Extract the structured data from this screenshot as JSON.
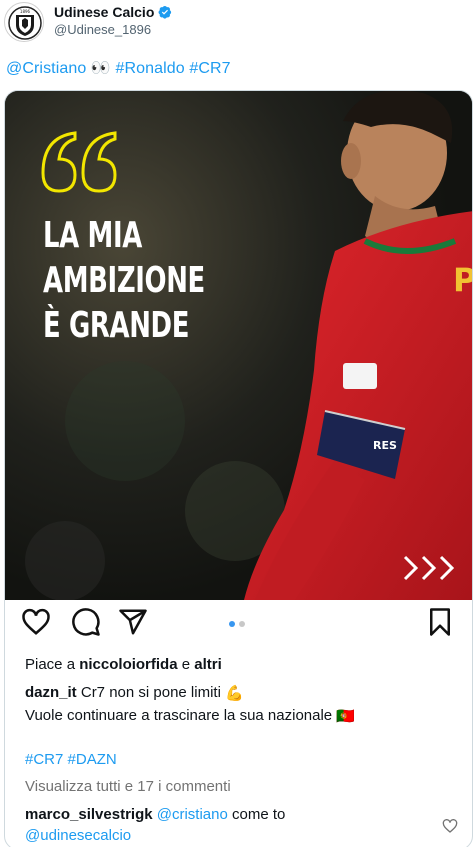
{
  "tweet": {
    "display_name": "Udinese Calcio",
    "handle": "@Udinese_1896",
    "verified_icon": "verified-badge-icon",
    "text_mention": "@Cristiano",
    "text_emoji": "👀",
    "text_tags": "#Ronaldo #CR7"
  },
  "instagram_post": {
    "photo": {
      "quote_lines": [
        "LA MIA",
        "AMBIZIONE",
        "È GRANDE"
      ],
      "jersey_text": "P",
      "colors": {
        "quote_mark": "#f2e600",
        "jersey_red": "#d4181f",
        "armband": "#1b2450"
      }
    },
    "actions": {
      "icons": [
        "heart-icon",
        "comment-icon",
        "share-icon",
        "bookmark-icon"
      ],
      "carousel_dots": 2,
      "active_dot": 1
    },
    "likes": {
      "prefix": "Piace a",
      "user": "niccoloiorfida",
      "joiner": "e",
      "others": "altri"
    },
    "caption": {
      "user": "dazn_it",
      "line1": "Cr7 non si pone limiti",
      "emoji1": "💪",
      "line2": "Vuole continuare a trascinare la sua nazionale",
      "emoji2": "🇵🇹"
    },
    "hashtags": "#CR7 #DAZN",
    "view_comments": "Visualizza tutti e 17 i commenti",
    "comment": {
      "user": "marco_silvestrigk",
      "mention": "@cristiano",
      "text": "come to",
      "mention2": "@udinesecalcio"
    }
  }
}
